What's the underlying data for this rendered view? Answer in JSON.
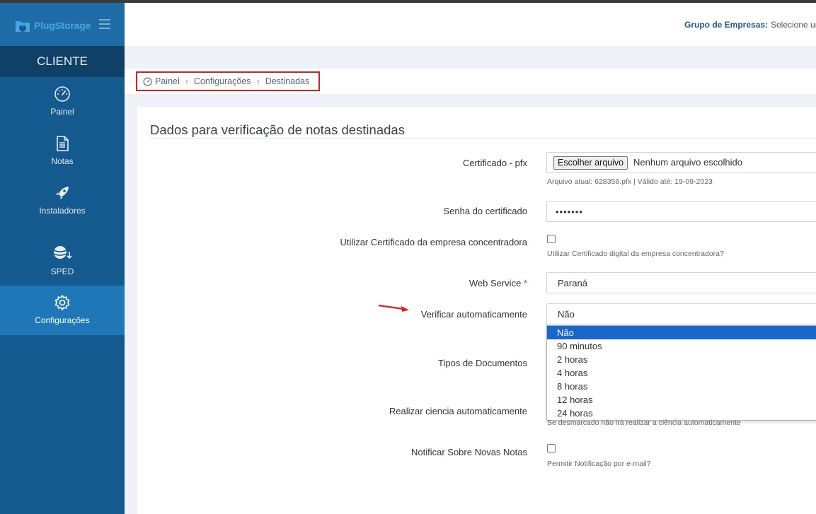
{
  "brand": {
    "name_part1": "Plug",
    "name_part2": "Storage"
  },
  "sidebar": {
    "section": "CLIENTE",
    "items": [
      {
        "label": "Painel",
        "icon": "speedometer-icon"
      },
      {
        "label": "Notas",
        "icon": "document-icon"
      },
      {
        "label": "Instaladores",
        "icon": "rocket-icon"
      },
      {
        "label": "SPED",
        "icon": "database-download-icon"
      },
      {
        "label": "Configurações",
        "icon": "gear-icon",
        "active": true
      }
    ]
  },
  "header": {
    "group_label": "Grupo de Empresas:",
    "group_value": "Selecione ur"
  },
  "breadcrumb": {
    "items": [
      "Painel",
      "Configurações",
      "Destinadas"
    ],
    "highlight_color": "#e01c1c"
  },
  "form": {
    "title": "Dados para verificação de notas destinadas",
    "certificado": {
      "label": "Certificado - pfx",
      "button": "Escolher arquivo",
      "file_text": "Nenhum arquivo escolhido",
      "help": "Arquivo atual: 628356.pfx | Válido até: 19-09-2023"
    },
    "senha": {
      "label": "Senha do certificado",
      "value": "•••••••"
    },
    "concentradora": {
      "label": "Utilizar Certificado da empresa concentradora",
      "checked": false,
      "help": "Utilizar Certificado digital da empresa concentradora?"
    },
    "webservice": {
      "label": "Web Service",
      "required_mark": "*",
      "value": "Paraná"
    },
    "verificar": {
      "label": "Verificar automaticamente",
      "value": "Não",
      "options": [
        "Não",
        "90 minutos",
        "2 horas",
        "4 horas",
        "8 horas",
        "12 horas",
        "24 horas"
      ]
    },
    "tipos": {
      "label": "Tipos de Documentos"
    },
    "ciencia": {
      "label": "Realizar ciencia automaticamente",
      "help": "Se desmarcado não irá realizar a ciência automaticamente"
    },
    "notificar": {
      "label": "Notificar Sobre Novas Notas",
      "checked": false,
      "help": "Permitir Notificação por e-mail?"
    }
  },
  "colors": {
    "sidebar": "#155a8f",
    "sidebar_active": "#1e78b7",
    "accent": "#1a66cc",
    "annotation": "#e01c1c"
  }
}
